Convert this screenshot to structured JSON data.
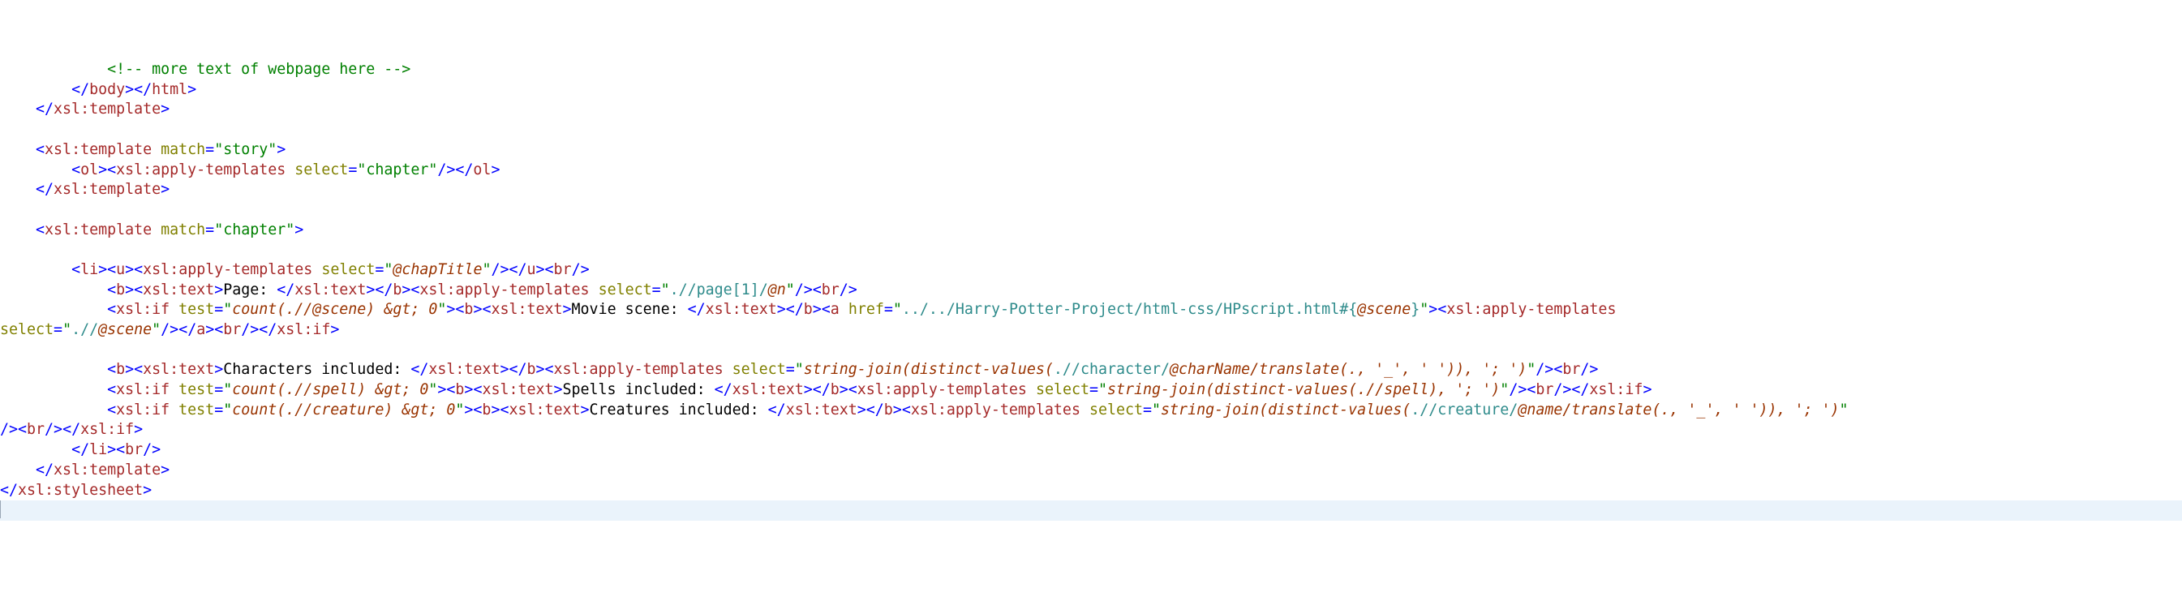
{
  "indent": "    ",
  "comment_more": "<!-- more text of webpage here -->",
  "tag": {
    "lt": "<",
    "gt": ">",
    "ltc": "</",
    "sc": "/>",
    "body": "body",
    "html": "html",
    "xsl_template": "xsl:template",
    "xsl_apply_templates": "xsl:apply-templates",
    "xsl_text": "xsl:text",
    "xsl_if": "xsl:if",
    "xsl_stylesheet": "xsl:stylesheet",
    "ol": "ol",
    "li": "li",
    "u": "u",
    "b": "b",
    "br": "br",
    "a": "a"
  },
  "attr": {
    "match": "match",
    "select": "select",
    "test": "test",
    "href": "href"
  },
  "val": {
    "story": "\"story\"",
    "chapter_sel": "\"chapter\"",
    "chapter_match": "\"chapter\"",
    "chapTitle_q1": "\"",
    "chapTitle_at": "@chapTitle",
    "chapTitle_q2": "\"",
    "page_sel_q1": "\"",
    "page_sel_body": ".//page[1]/",
    "page_sel_at": "@n",
    "page_sel_q2": "\"",
    "scene_test_q1": "\"",
    "scene_test_body": "count(.//@scene) &gt; 0",
    "scene_test_q2": "\"",
    "href_q1": "\"",
    "href_body": "../../Harry-Potter-Project/html-css/HPscript.html#{",
    "href_at": "@scene",
    "href_tail": "}",
    "href_q2": "\"",
    "scene_sel_q1": "\"",
    "scene_sel_body": ".//",
    "scene_sel_at": "@scene",
    "scene_sel_q2": "\"",
    "chars_sel_q1": "\"",
    "chars_sel_p1": "string-join(distinct-values(",
    "chars_sel_p2": ".//character/",
    "chars_sel_at": "@charName",
    "chars_sel_p3": "/translate(., '_', ' ')), '; ')",
    "chars_sel_q2": "\"",
    "spell_test_q1": "\"",
    "spell_test_body": "count(.//spell) &gt; 0",
    "spell_test_q2": "\"",
    "spells_sel_q1": "\"",
    "spells_sel_body": "string-join(distinct-values(.//spell), '; ')",
    "spells_sel_q2": "\"",
    "creature_test_q1": "\"",
    "creature_test_body": "count(.//creature) &gt; 0",
    "creature_test_q2": "\"",
    "creatures_sel_q1": "\"",
    "creatures_sel_p1": "string-join(distinct-values(",
    "creatures_sel_p2": ".//creature/",
    "creatures_sel_at": "@name",
    "creatures_sel_p3": "/translate(., '_', ' ')), '; ')",
    "creatures_sel_q2": "\""
  },
  "text": {
    "page": "Page: ",
    "movie_scene": "Movie scene: ",
    "chars_inc": "Characters included: ",
    "spells_inc": "Spells included: ",
    "creatures_inc": "Creatures included: "
  }
}
